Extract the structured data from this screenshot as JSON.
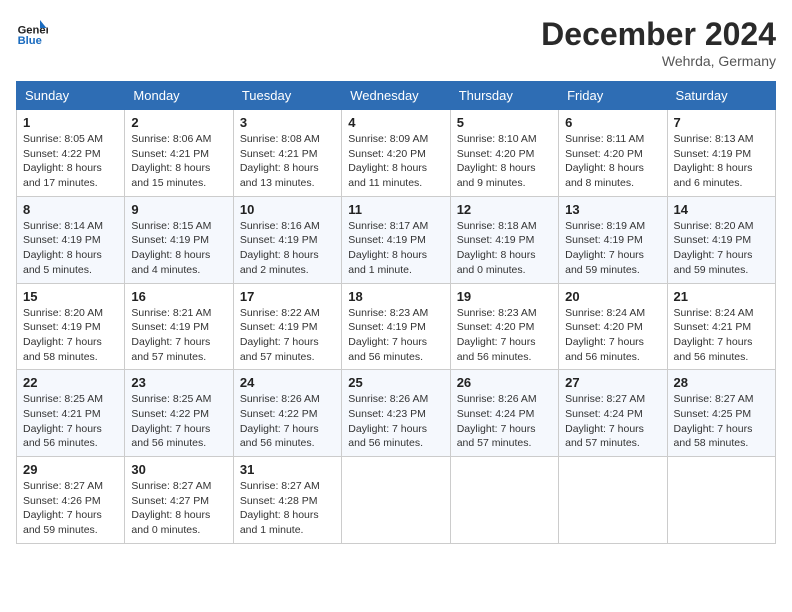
{
  "logo": {
    "text_general": "General",
    "text_blue": "Blue"
  },
  "header": {
    "month": "December 2024",
    "location": "Wehrda, Germany"
  },
  "weekdays": [
    "Sunday",
    "Monday",
    "Tuesday",
    "Wednesday",
    "Thursday",
    "Friday",
    "Saturday"
  ],
  "weeks": [
    [
      {
        "day": "1",
        "info": "Sunrise: 8:05 AM\nSunset: 4:22 PM\nDaylight: 8 hours and 17 minutes."
      },
      {
        "day": "2",
        "info": "Sunrise: 8:06 AM\nSunset: 4:21 PM\nDaylight: 8 hours and 15 minutes."
      },
      {
        "day": "3",
        "info": "Sunrise: 8:08 AM\nSunset: 4:21 PM\nDaylight: 8 hours and 13 minutes."
      },
      {
        "day": "4",
        "info": "Sunrise: 8:09 AM\nSunset: 4:20 PM\nDaylight: 8 hours and 11 minutes."
      },
      {
        "day": "5",
        "info": "Sunrise: 8:10 AM\nSunset: 4:20 PM\nDaylight: 8 hours and 9 minutes."
      },
      {
        "day": "6",
        "info": "Sunrise: 8:11 AM\nSunset: 4:20 PM\nDaylight: 8 hours and 8 minutes."
      },
      {
        "day": "7",
        "info": "Sunrise: 8:13 AM\nSunset: 4:19 PM\nDaylight: 8 hours and 6 minutes."
      }
    ],
    [
      {
        "day": "8",
        "info": "Sunrise: 8:14 AM\nSunset: 4:19 PM\nDaylight: 8 hours and 5 minutes."
      },
      {
        "day": "9",
        "info": "Sunrise: 8:15 AM\nSunset: 4:19 PM\nDaylight: 8 hours and 4 minutes."
      },
      {
        "day": "10",
        "info": "Sunrise: 8:16 AM\nSunset: 4:19 PM\nDaylight: 8 hours and 2 minutes."
      },
      {
        "day": "11",
        "info": "Sunrise: 8:17 AM\nSunset: 4:19 PM\nDaylight: 8 hours and 1 minute."
      },
      {
        "day": "12",
        "info": "Sunrise: 8:18 AM\nSunset: 4:19 PM\nDaylight: 8 hours and 0 minutes."
      },
      {
        "day": "13",
        "info": "Sunrise: 8:19 AM\nSunset: 4:19 PM\nDaylight: 7 hours and 59 minutes."
      },
      {
        "day": "14",
        "info": "Sunrise: 8:20 AM\nSunset: 4:19 PM\nDaylight: 7 hours and 59 minutes."
      }
    ],
    [
      {
        "day": "15",
        "info": "Sunrise: 8:20 AM\nSunset: 4:19 PM\nDaylight: 7 hours and 58 minutes."
      },
      {
        "day": "16",
        "info": "Sunrise: 8:21 AM\nSunset: 4:19 PM\nDaylight: 7 hours and 57 minutes."
      },
      {
        "day": "17",
        "info": "Sunrise: 8:22 AM\nSunset: 4:19 PM\nDaylight: 7 hours and 57 minutes."
      },
      {
        "day": "18",
        "info": "Sunrise: 8:23 AM\nSunset: 4:19 PM\nDaylight: 7 hours and 56 minutes."
      },
      {
        "day": "19",
        "info": "Sunrise: 8:23 AM\nSunset: 4:20 PM\nDaylight: 7 hours and 56 minutes."
      },
      {
        "day": "20",
        "info": "Sunrise: 8:24 AM\nSunset: 4:20 PM\nDaylight: 7 hours and 56 minutes."
      },
      {
        "day": "21",
        "info": "Sunrise: 8:24 AM\nSunset: 4:21 PM\nDaylight: 7 hours and 56 minutes."
      }
    ],
    [
      {
        "day": "22",
        "info": "Sunrise: 8:25 AM\nSunset: 4:21 PM\nDaylight: 7 hours and 56 minutes."
      },
      {
        "day": "23",
        "info": "Sunrise: 8:25 AM\nSunset: 4:22 PM\nDaylight: 7 hours and 56 minutes."
      },
      {
        "day": "24",
        "info": "Sunrise: 8:26 AM\nSunset: 4:22 PM\nDaylight: 7 hours and 56 minutes."
      },
      {
        "day": "25",
        "info": "Sunrise: 8:26 AM\nSunset: 4:23 PM\nDaylight: 7 hours and 56 minutes."
      },
      {
        "day": "26",
        "info": "Sunrise: 8:26 AM\nSunset: 4:24 PM\nDaylight: 7 hours and 57 minutes."
      },
      {
        "day": "27",
        "info": "Sunrise: 8:27 AM\nSunset: 4:24 PM\nDaylight: 7 hours and 57 minutes."
      },
      {
        "day": "28",
        "info": "Sunrise: 8:27 AM\nSunset: 4:25 PM\nDaylight: 7 hours and 58 minutes."
      }
    ],
    [
      {
        "day": "29",
        "info": "Sunrise: 8:27 AM\nSunset: 4:26 PM\nDaylight: 7 hours and 59 minutes."
      },
      {
        "day": "30",
        "info": "Sunrise: 8:27 AM\nSunset: 4:27 PM\nDaylight: 8 hours and 0 minutes."
      },
      {
        "day": "31",
        "info": "Sunrise: 8:27 AM\nSunset: 4:28 PM\nDaylight: 8 hours and 1 minute."
      },
      null,
      null,
      null,
      null
    ]
  ]
}
